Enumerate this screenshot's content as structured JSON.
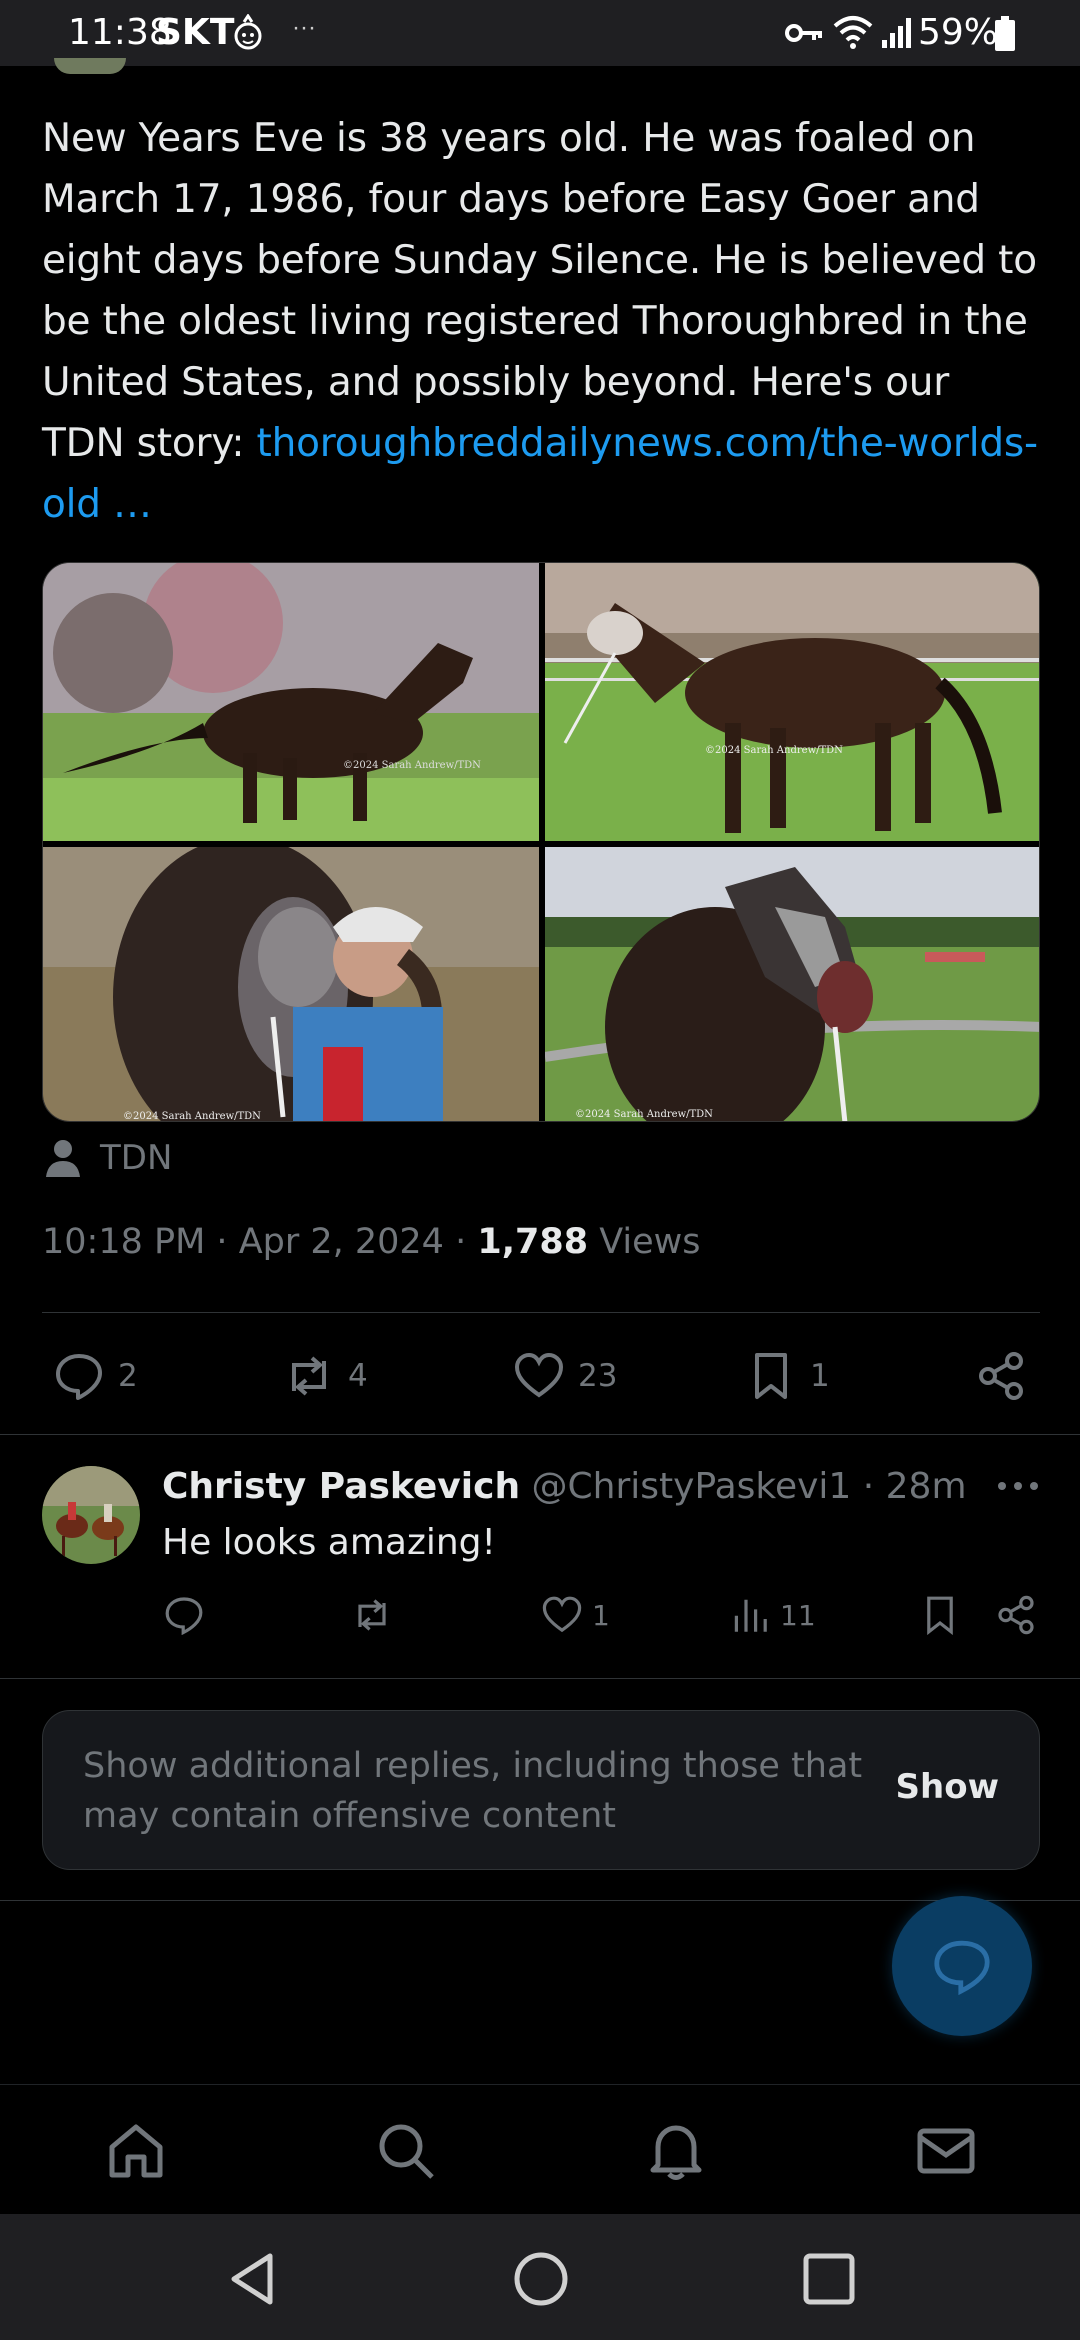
{
  "status_bar": {
    "time": "11:38",
    "carrier": "SKT",
    "battery": "59%",
    "more_indicator": "···"
  },
  "post": {
    "text_main": "New Years Eve is 38 years old. He was foaled on March 17, 1986, four days before Easy Goer and eight days before Sunday Silence. He is believed to be the oldest living registered Thoroughbred in the United States, and possibly beyond. Here's our TDN story: ",
    "link_text": "thoroughbreddailynews.com/the-worlds-old …",
    "media_credit": "TDN",
    "time": "10:18 PM",
    "date": "Apr 2, 2024",
    "views_count": "1,788",
    "views_label": "Views",
    "meta_sep": " · ",
    "photo_watermark": "©2024 Sarah Andrew/TDN"
  },
  "actions": {
    "replies": "2",
    "reposts": "4",
    "likes": "23",
    "bookmarks": "1"
  },
  "reply": {
    "name": "Christy Paskevich",
    "handle": "@ChristyPaskevi1",
    "time": "28m",
    "body": "He looks amazing!",
    "likes": "1",
    "views": "11"
  },
  "show_more": {
    "text": "Show additional replies, including those that may contain offensive content",
    "button": "Show"
  },
  "icons": {
    "tabs": [
      "home-icon",
      "search-icon",
      "bell-icon",
      "mail-icon"
    ],
    "nav": [
      "back-icon",
      "home-circle-icon",
      "recents-icon"
    ]
  },
  "colors": {
    "accent": "#1d9bf0",
    "muted": "#71767b",
    "text": "#e7e9ea",
    "background": "#000000",
    "fab": "#0a3d63"
  }
}
